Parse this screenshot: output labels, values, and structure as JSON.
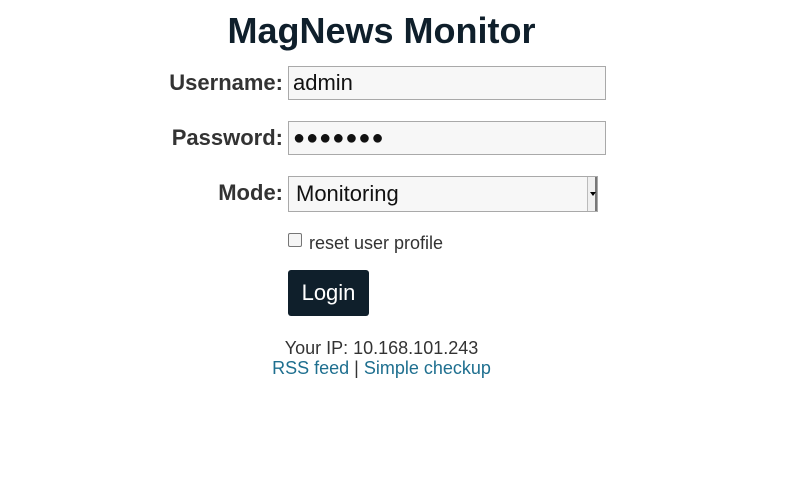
{
  "header": {
    "title": "MagNews Monitor"
  },
  "form": {
    "username_label": "Username:",
    "username_value": "admin",
    "password_label": "Password:",
    "password_masked": "●●●●●●●",
    "mode_label": "Mode:",
    "mode_selected": "Monitoring",
    "reset_profile_label": "reset user profile",
    "reset_profile_checked": false,
    "login_label": "Login"
  },
  "footer": {
    "ip_text": "Your IP: 10.168.101.243",
    "rss_link": "RSS feed",
    "separator": "|",
    "checkup_link": "Simple checkup"
  },
  "colors": {
    "title": "#0f1f2b",
    "button_bg": "#0f1f2b",
    "link": "#1e6f8f"
  }
}
